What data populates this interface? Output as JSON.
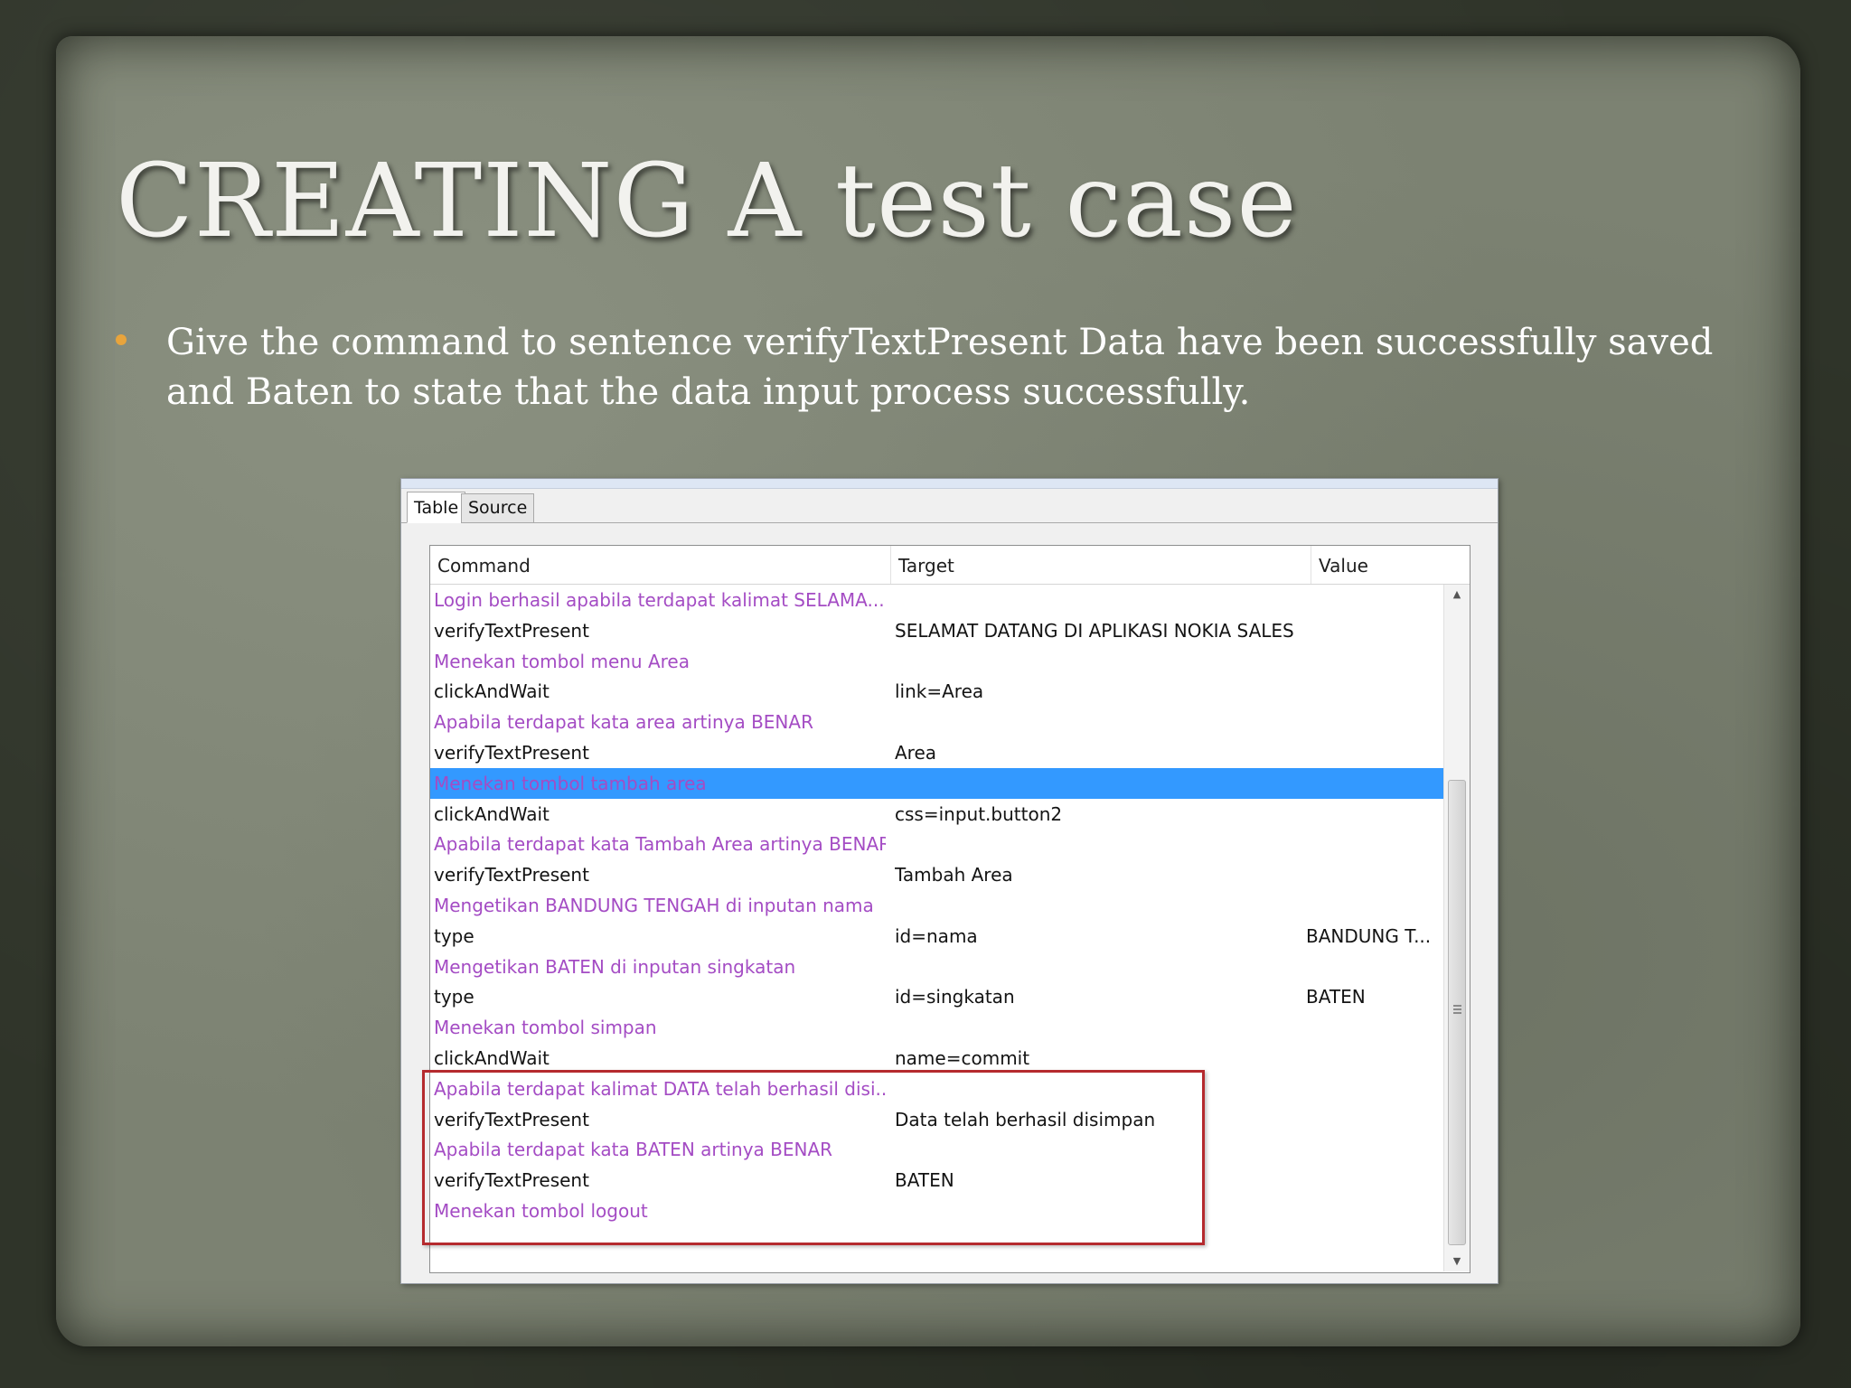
{
  "slide": {
    "title": "CREATING A test case",
    "bullets": [
      "Give the command to sentence verifyTextPresent Data have been successfully saved and Baten to state that the data input process successfully."
    ]
  },
  "ide": {
    "tabs": [
      {
        "label": "Table",
        "active": true
      },
      {
        "label": "Source",
        "active": false
      }
    ],
    "columns": {
      "command": "Command",
      "target": "Target",
      "value": "Value"
    },
    "rows": [
      {
        "type": "comment",
        "command": "Login berhasil apabila terdapat kalimat  SELAMA...",
        "target": "",
        "value": ""
      },
      {
        "type": "command",
        "command": "verifyTextPresent",
        "target": "SELAMAT DATANG DI APLIKASI NOKIA SALES",
        "value": ""
      },
      {
        "type": "comment",
        "command": "Menekan tombol menu Area",
        "target": "",
        "value": ""
      },
      {
        "type": "command",
        "command": "clickAndWait",
        "target": "link=Area",
        "value": ""
      },
      {
        "type": "comment",
        "command": "Apabila terdapat kata area artinya BENAR",
        "target": "",
        "value": ""
      },
      {
        "type": "command",
        "command": "verifyTextPresent",
        "target": "Area",
        "value": ""
      },
      {
        "type": "comment",
        "command": "Menekan tombol tambah area",
        "target": "",
        "value": "",
        "selected": true
      },
      {
        "type": "command",
        "command": "clickAndWait",
        "target": "css=input.button2",
        "value": ""
      },
      {
        "type": "comment",
        "command": "Apabila terdapat kata Tambah Area artinya BENAR",
        "target": "",
        "value": ""
      },
      {
        "type": "command",
        "command": "verifyTextPresent",
        "target": "Tambah Area",
        "value": ""
      },
      {
        "type": "comment",
        "command": "Mengetikan BANDUNG TENGAH di inputan nama",
        "target": "",
        "value": ""
      },
      {
        "type": "command",
        "command": "type",
        "target": "id=nama",
        "value": "BANDUNG T..."
      },
      {
        "type": "comment",
        "command": "Mengetikan BATEN di inputan singkatan",
        "target": "",
        "value": ""
      },
      {
        "type": "command",
        "command": "type",
        "target": "id=singkatan",
        "value": "BATEN"
      },
      {
        "type": "comment",
        "command": "Menekan tombol simpan",
        "target": "",
        "value": ""
      },
      {
        "type": "command",
        "command": "clickAndWait",
        "target": "name=commit",
        "value": ""
      },
      {
        "type": "comment",
        "command": "Apabila terdapat kalimat DATA telah berhasil disi...",
        "target": "",
        "value": ""
      },
      {
        "type": "command",
        "command": "verifyTextPresent",
        "target": "Data telah berhasil disimpan",
        "value": ""
      },
      {
        "type": "comment",
        "command": "Apabila terdapat kata BATEN artinya BENAR",
        "target": "",
        "value": ""
      },
      {
        "type": "command",
        "command": "verifyTextPresent",
        "target": "BATEN",
        "value": ""
      },
      {
        "type": "comment",
        "command": "Menekan tombol logout",
        "target": "",
        "value": ""
      }
    ],
    "scrollbar": {
      "up_glyph": "▲",
      "down_glyph": "▼"
    }
  },
  "colors": {
    "comment_text": "#a44cc4",
    "selection": "#3399ff",
    "highlight_border": "#b52a2e",
    "bullet": "#e8a43c"
  }
}
